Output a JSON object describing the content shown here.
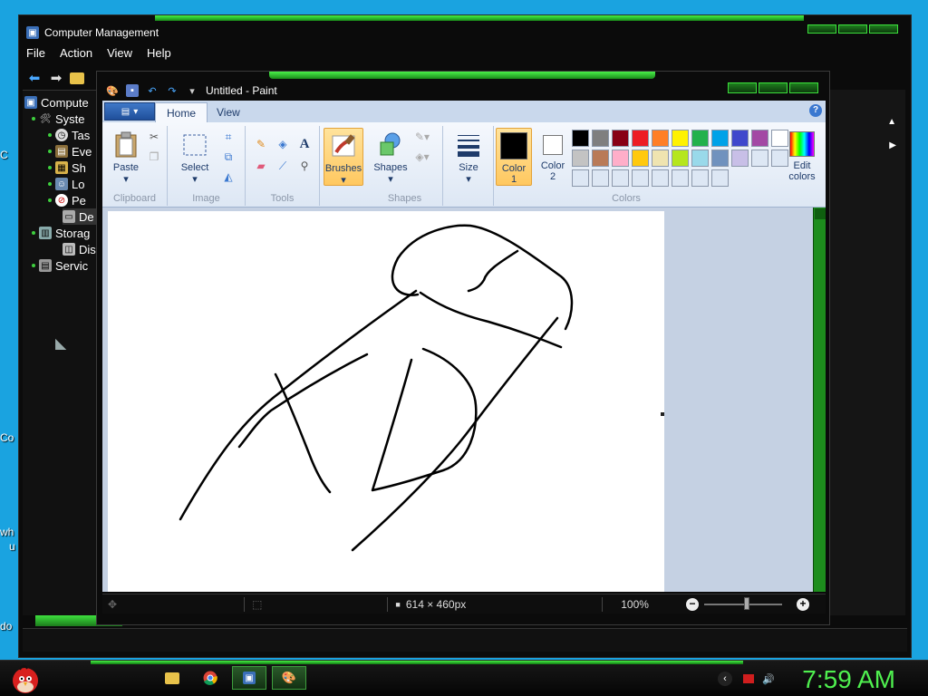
{
  "desktop": {
    "fragments": [
      "C",
      "Co",
      "wh",
      "u",
      "do"
    ]
  },
  "cm_window": {
    "title": "Computer Management",
    "menu": [
      "File",
      "Action",
      "View",
      "Help"
    ],
    "tree": [
      {
        "label": "Compute",
        "icon": "computer-management-icon"
      },
      {
        "label": "Syste",
        "icon": "system-tools-icon"
      },
      {
        "label": "Tas",
        "icon": "task-scheduler-icon"
      },
      {
        "label": "Eve",
        "icon": "event-viewer-icon"
      },
      {
        "label": "Sh",
        "icon": "shared-folders-icon"
      },
      {
        "label": "Lo",
        "icon": "local-users-icon"
      },
      {
        "label": "Pe",
        "icon": "performance-icon"
      },
      {
        "label": "De",
        "icon": "device-manager-icon"
      },
      {
        "label": "Storag",
        "icon": "storage-icon"
      },
      {
        "label": "Dis",
        "icon": "disk-management-icon"
      },
      {
        "label": "Servic",
        "icon": "services-icon"
      }
    ]
  },
  "paint": {
    "title": "Untitled - Paint",
    "tabs": [
      "Home",
      "View"
    ],
    "app_menu_icon": "app-menu-icon",
    "groups": {
      "clipboard": {
        "label": "Clipboard",
        "paste": "Paste"
      },
      "image": {
        "label": "Image",
        "select": "Select"
      },
      "tools": {
        "label": "Tools"
      },
      "brushes": {
        "label": "Brushes"
      },
      "shapes": {
        "label": "Shapes",
        "shapes_btn": "Shapes"
      },
      "size": {
        "label": "Size"
      },
      "colors": {
        "label": "Colors",
        "color1_label": "Color\n1",
        "color1_line1": "Color",
        "color1_line2": "1",
        "color2_line1": "Color",
        "color2_line2": "2",
        "edit_line1": "Edit",
        "edit_line2": "colors",
        "palette_row1": [
          "#000000",
          "#7f7f7f",
          "#880015",
          "#ed1c24",
          "#ff7f27",
          "#fff200",
          "#22b14c",
          "#00a2e8",
          "#3f48cc",
          "#a349a4"
        ],
        "palette_row2": [
          "#ffffff",
          "#c3c3c3",
          "#b97a57",
          "#ffaec9",
          "#ffc90e",
          "#efe4b0",
          "#b5e61d",
          "#99d9ea",
          "#7092be",
          "#c8bfe7"
        ],
        "palette_row3": [
          "#dde7f4",
          "#dde7f4",
          "#dde7f4",
          "#dde7f4",
          "#dde7f4",
          "#dde7f4",
          "#dde7f4",
          "#dde7f4",
          "#dde7f4",
          "#dde7f4"
        ]
      }
    },
    "status": {
      "canvas_size": "614 × 460px",
      "zoom": "100%"
    }
  },
  "taskbar": {
    "clock": "7:59 AM",
    "accent": "#4ff04f"
  }
}
